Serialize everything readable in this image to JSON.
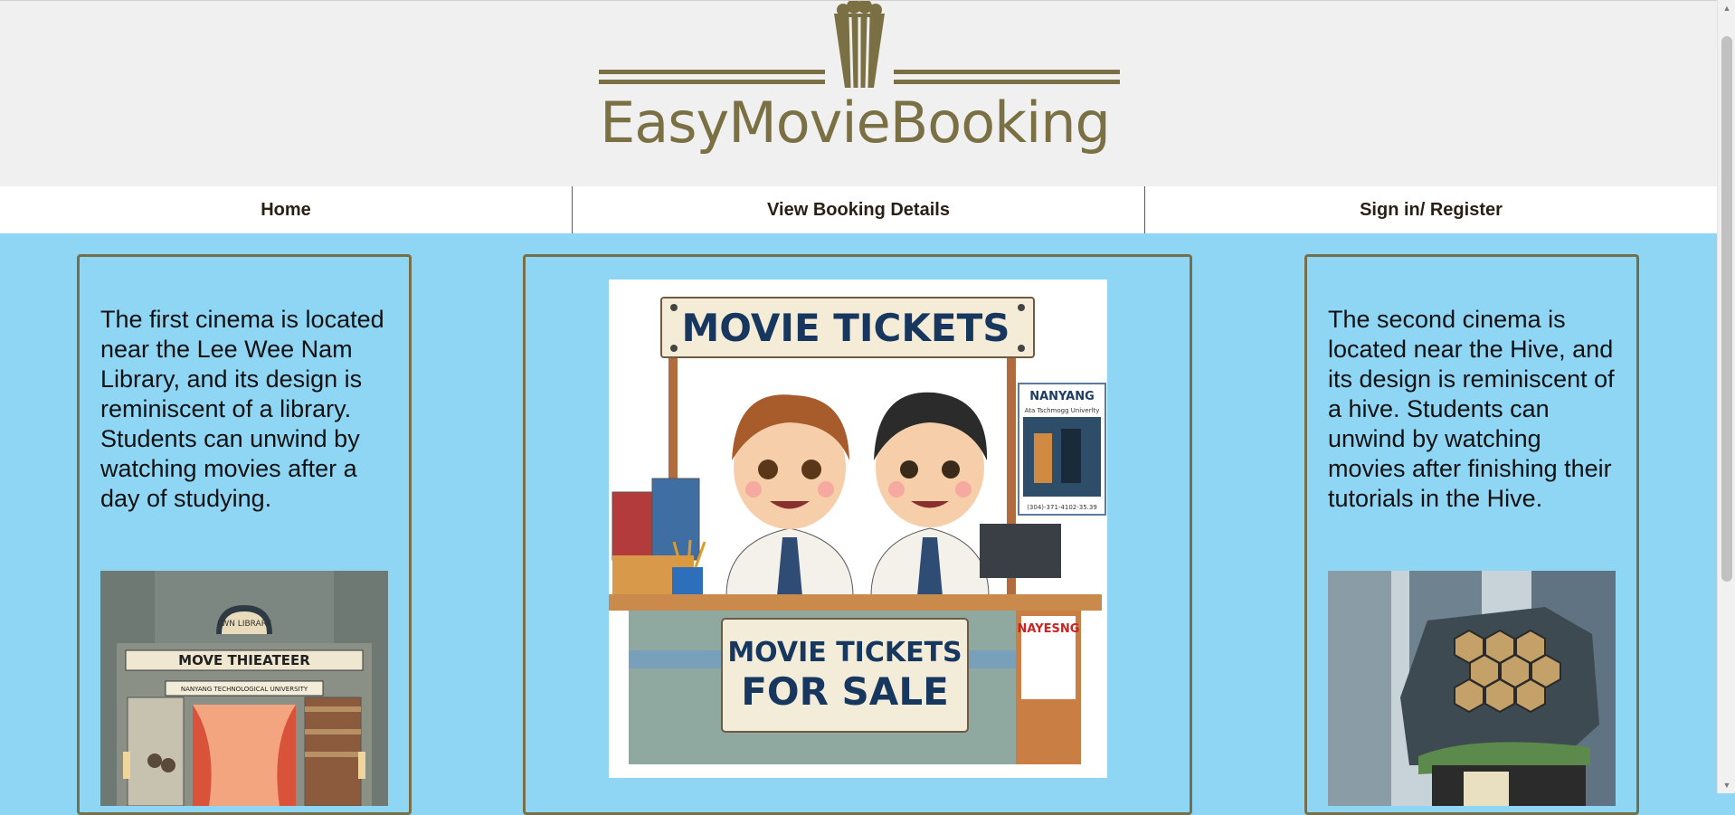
{
  "brand": {
    "name": "EasyMovieBooking"
  },
  "nav": {
    "home": "Home",
    "booking": "View Booking Details",
    "signin": "Sign in/ Register"
  },
  "cinema1": {
    "description": "The first cinema is located near the Lee Wee Nam Library, and its design is reminiscent of a library. Students can unwind by watching movies after a day of studying.",
    "sign_top": "LWN LIBRARY",
    "sign_main": "MOVE THIEATEER",
    "sign_sub": "NANYANG TECHNOLOGICAL UNIVERSITY"
  },
  "poster": {
    "banner": "MOVIE TICKETS",
    "sale_line1": "MOVIE TICKETS",
    "sale_line2": "FOR SALE",
    "side_poster_title": "NANYANG",
    "side_poster_sub": "Ata Tschmogg Univerlty",
    "side_poster_footer": "(304)-371-4102-35.39",
    "counter_label": "NAYESNG"
  },
  "cinema2": {
    "description": "The second cinema is located near the Hive, and its design is reminiscent of a hive. Students can unwind by watching movies after finishing their tutorials in the Hive."
  },
  "colors": {
    "page_bg": "#8fd6f5",
    "brand": "#7a7044",
    "card_border": "#76704a"
  }
}
